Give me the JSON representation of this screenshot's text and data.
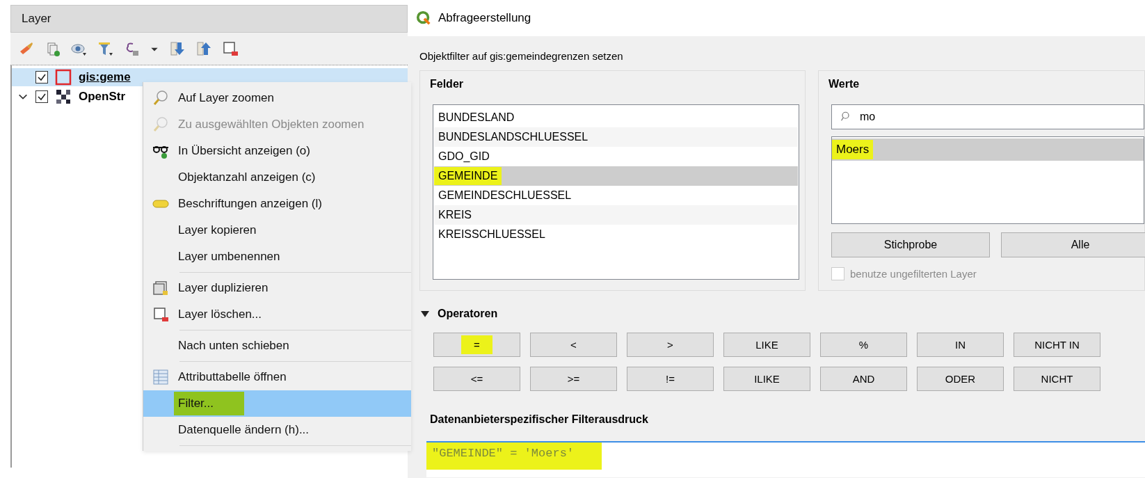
{
  "layer_panel": {
    "title": "Layer",
    "layers": [
      {
        "name": "gis:geme",
        "checked": true,
        "selected": true,
        "expanded": false,
        "kind": "vector"
      },
      {
        "name": "OpenStr",
        "checked": true,
        "selected": false,
        "expanded": true,
        "kind": "raster"
      }
    ]
  },
  "context_menu": {
    "groups": [
      [
        {
          "label": "Auf Layer zoomen",
          "disabled": false,
          "selected": false,
          "highlighted": false
        },
        {
          "label": "Zu ausgewählten Objekten zoomen",
          "disabled": true,
          "selected": false,
          "highlighted": false
        },
        {
          "label": "In Übersicht anzeigen (o)",
          "disabled": false,
          "selected": false,
          "highlighted": false
        },
        {
          "label": "Objektanzahl anzeigen (c)",
          "disabled": false,
          "selected": false,
          "highlighted": false
        },
        {
          "label": "Beschriftungen anzeigen (l)",
          "disabled": false,
          "selected": false,
          "highlighted": false
        },
        {
          "label": "Layer kopieren",
          "disabled": false,
          "selected": false,
          "highlighted": false
        },
        {
          "label": "Layer umbenennen",
          "disabled": false,
          "selected": false,
          "highlighted": false
        }
      ],
      [
        {
          "label": "Layer duplizieren",
          "disabled": false,
          "selected": false,
          "highlighted": false
        },
        {
          "label": "Layer löschen...",
          "disabled": false,
          "selected": false,
          "highlighted": false
        }
      ],
      [
        {
          "label": "Nach unten schieben",
          "disabled": false,
          "selected": false,
          "highlighted": false
        }
      ],
      [
        {
          "label": "Attributtabelle öffnen",
          "disabled": false,
          "selected": false,
          "highlighted": false
        },
        {
          "label": "Filter...",
          "disabled": false,
          "selected": true,
          "highlighted": true
        },
        {
          "label": "Datenquelle ändern (h)...",
          "disabled": false,
          "selected": false,
          "highlighted": false
        }
      ]
    ]
  },
  "dialog": {
    "title": "Abfrageerstellung",
    "subtitle": "Objektfilter auf gis:gemeindegrenzen setzen",
    "fields": {
      "title": "Felder",
      "items": [
        {
          "label": "BUNDESLAND",
          "selected": false,
          "highlighted": false
        },
        {
          "label": "BUNDESLANDSCHLUESSEL",
          "selected": false,
          "highlighted": false
        },
        {
          "label": "GDO_GID",
          "selected": false,
          "highlighted": false
        },
        {
          "label": "GEMEINDE",
          "selected": true,
          "highlighted": true
        },
        {
          "label": "GEMEINDESCHLUESSEL",
          "selected": false,
          "highlighted": false
        },
        {
          "label": "KREIS",
          "selected": false,
          "highlighted": false
        },
        {
          "label": "KREISSCHLUESSEL",
          "selected": false,
          "highlighted": false
        }
      ]
    },
    "values": {
      "title": "Werte",
      "search": "mo",
      "items": [
        {
          "label": "Moers",
          "selected": true,
          "highlighted": true
        }
      ],
      "buttons": [
        "Stichprobe",
        "Alle"
      ],
      "unfiltered": {
        "label": "benutze ungefilterten Layer",
        "checked": false,
        "disabled": true
      }
    },
    "operators": {
      "title": "Operatoren",
      "expanded": true,
      "buttons": [
        {
          "label": "=",
          "highlighted": true
        },
        {
          "label": "<",
          "highlighted": false
        },
        {
          "label": ">",
          "highlighted": false
        },
        {
          "label": "LIKE",
          "highlighted": false
        },
        {
          "label": "%",
          "highlighted": false
        },
        {
          "label": "IN",
          "highlighted": false
        },
        {
          "label": "NICHT IN",
          "highlighted": false
        },
        {
          "label": "<=",
          "highlighted": false
        },
        {
          "label": ">=",
          "highlighted": false
        },
        {
          "label": "!=",
          "highlighted": false
        },
        {
          "label": "ILIKE",
          "highlighted": false
        },
        {
          "label": "AND",
          "highlighted": false
        },
        {
          "label": "ODER",
          "highlighted": false
        },
        {
          "label": "NICHT",
          "highlighted": false
        }
      ]
    },
    "expression": {
      "title": "Datenanbieterspezifischer Filterausdruck",
      "value": "\"GEMEINDE\" = 'Moers'",
      "highlighted": true
    }
  }
}
